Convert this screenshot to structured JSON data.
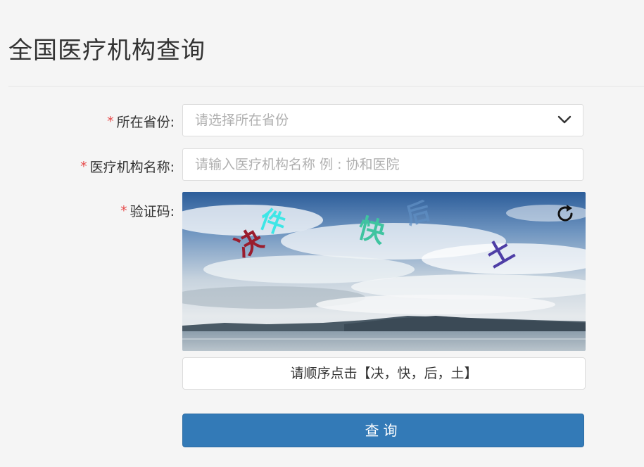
{
  "page": {
    "title": "全国医疗机构查询"
  },
  "form": {
    "province": {
      "required_mark": "*",
      "label": "所在省份:",
      "placeholder": "请选择所在省份"
    },
    "institution": {
      "required_mark": "*",
      "label": "医疗机构名称:",
      "placeholder": "请输入医疗机构名称  例 : 协和医院"
    },
    "captcha": {
      "required_mark": "*",
      "label": "验证码:",
      "chars": [
        {
          "char": "决",
          "color": "#9a1d2e"
        },
        {
          "char": "件",
          "color": "#3ee6e6"
        },
        {
          "char": "快",
          "color": "#3fc4a0"
        },
        {
          "char": "后",
          "color": "#5f8fc4"
        },
        {
          "char": "土",
          "color": "#4e3ea6"
        }
      ],
      "hint": "请顺序点击【决，快，后，土】",
      "refresh_icon": "refresh-icon"
    },
    "submit_label": "查询"
  },
  "colors": {
    "required": "#e64a4a",
    "primary_button": "#337ab7"
  }
}
